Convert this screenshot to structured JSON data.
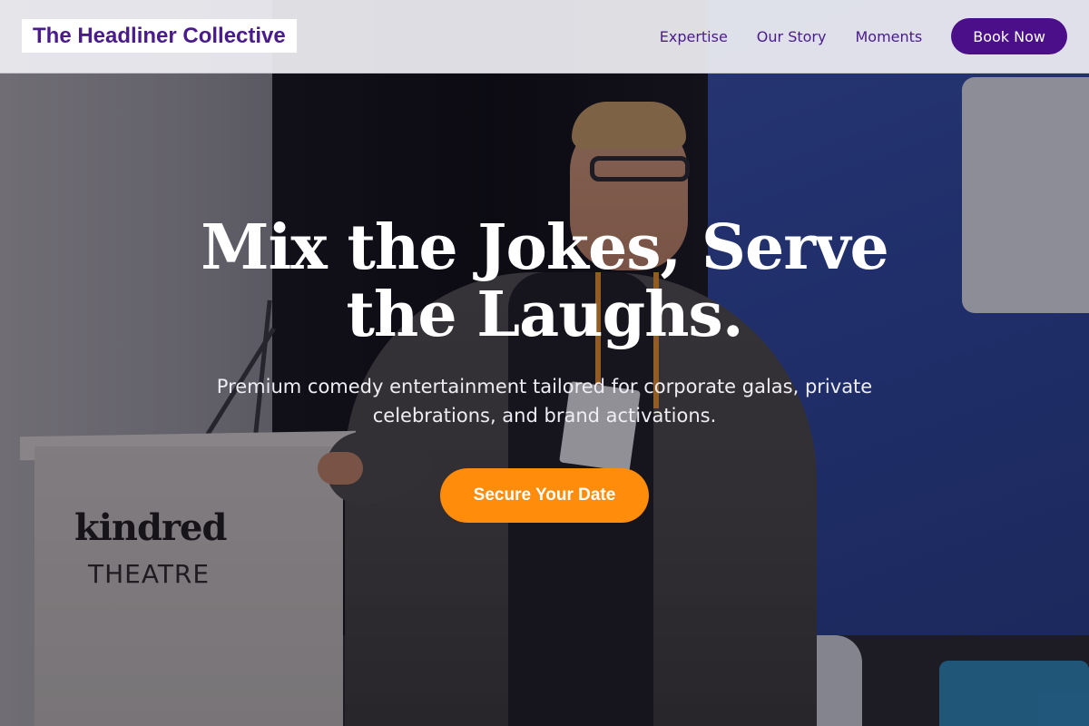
{
  "header": {
    "brand": "The Headliner Collective",
    "nav": [
      {
        "label": "Expertise"
      },
      {
        "label": "Our Story"
      },
      {
        "label": "Moments"
      }
    ],
    "cta": "Book Now"
  },
  "hero": {
    "title": "Mix the Jokes, Serve the Laughs.",
    "subtitle": "Premium comedy entertainment tailored for corporate galas, private celebrations, and brand activations.",
    "cta": "Secure Your Date"
  },
  "photo": {
    "podium_brand": "kindred",
    "podium_sub": "THEATRE"
  },
  "colors": {
    "brand": "#4a1b8c",
    "cta_dark": "#4b0f8a",
    "cta_orange": "#ff8c0a"
  }
}
